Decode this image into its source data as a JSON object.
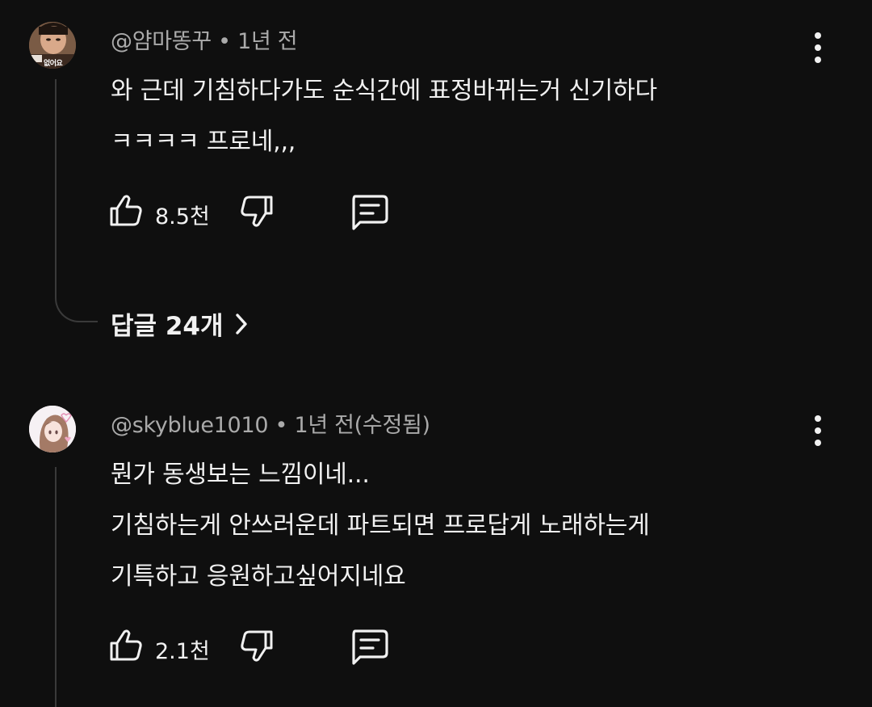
{
  "comments": [
    {
      "author": "@얌마똥꾸",
      "separator": "•",
      "time": "1년 전",
      "lines": [
        "와 근데 기침하다가도 순식간에 표정바뀌는거 신기하다",
        "ㅋㅋㅋㅋ 프로네,,,"
      ],
      "likes": "8.5천",
      "avatar_caption": "없어요",
      "replies_label": "답글 24개"
    },
    {
      "author": "@skyblue1010",
      "separator": "•",
      "time": "1년 전(수정됨)",
      "lines": [
        "뭔가 동생보는 느낌이네...",
        "기침하는게 안쓰러운데 파트되면 프로답게 노래하는게",
        "기특하고 응원하고싶어지네요"
      ],
      "likes": "2.1천"
    }
  ],
  "icons": {
    "like": "thumb-up-icon",
    "dislike": "thumb-down-icon",
    "reply": "comment-icon",
    "more": "more-vertical-icon",
    "expand": "chevron-right-icon"
  },
  "colors": {
    "background": "#0f0f0f",
    "text": "#f1f1f1",
    "meta": "#aaaaaa",
    "thread": "#3a3a3a"
  }
}
